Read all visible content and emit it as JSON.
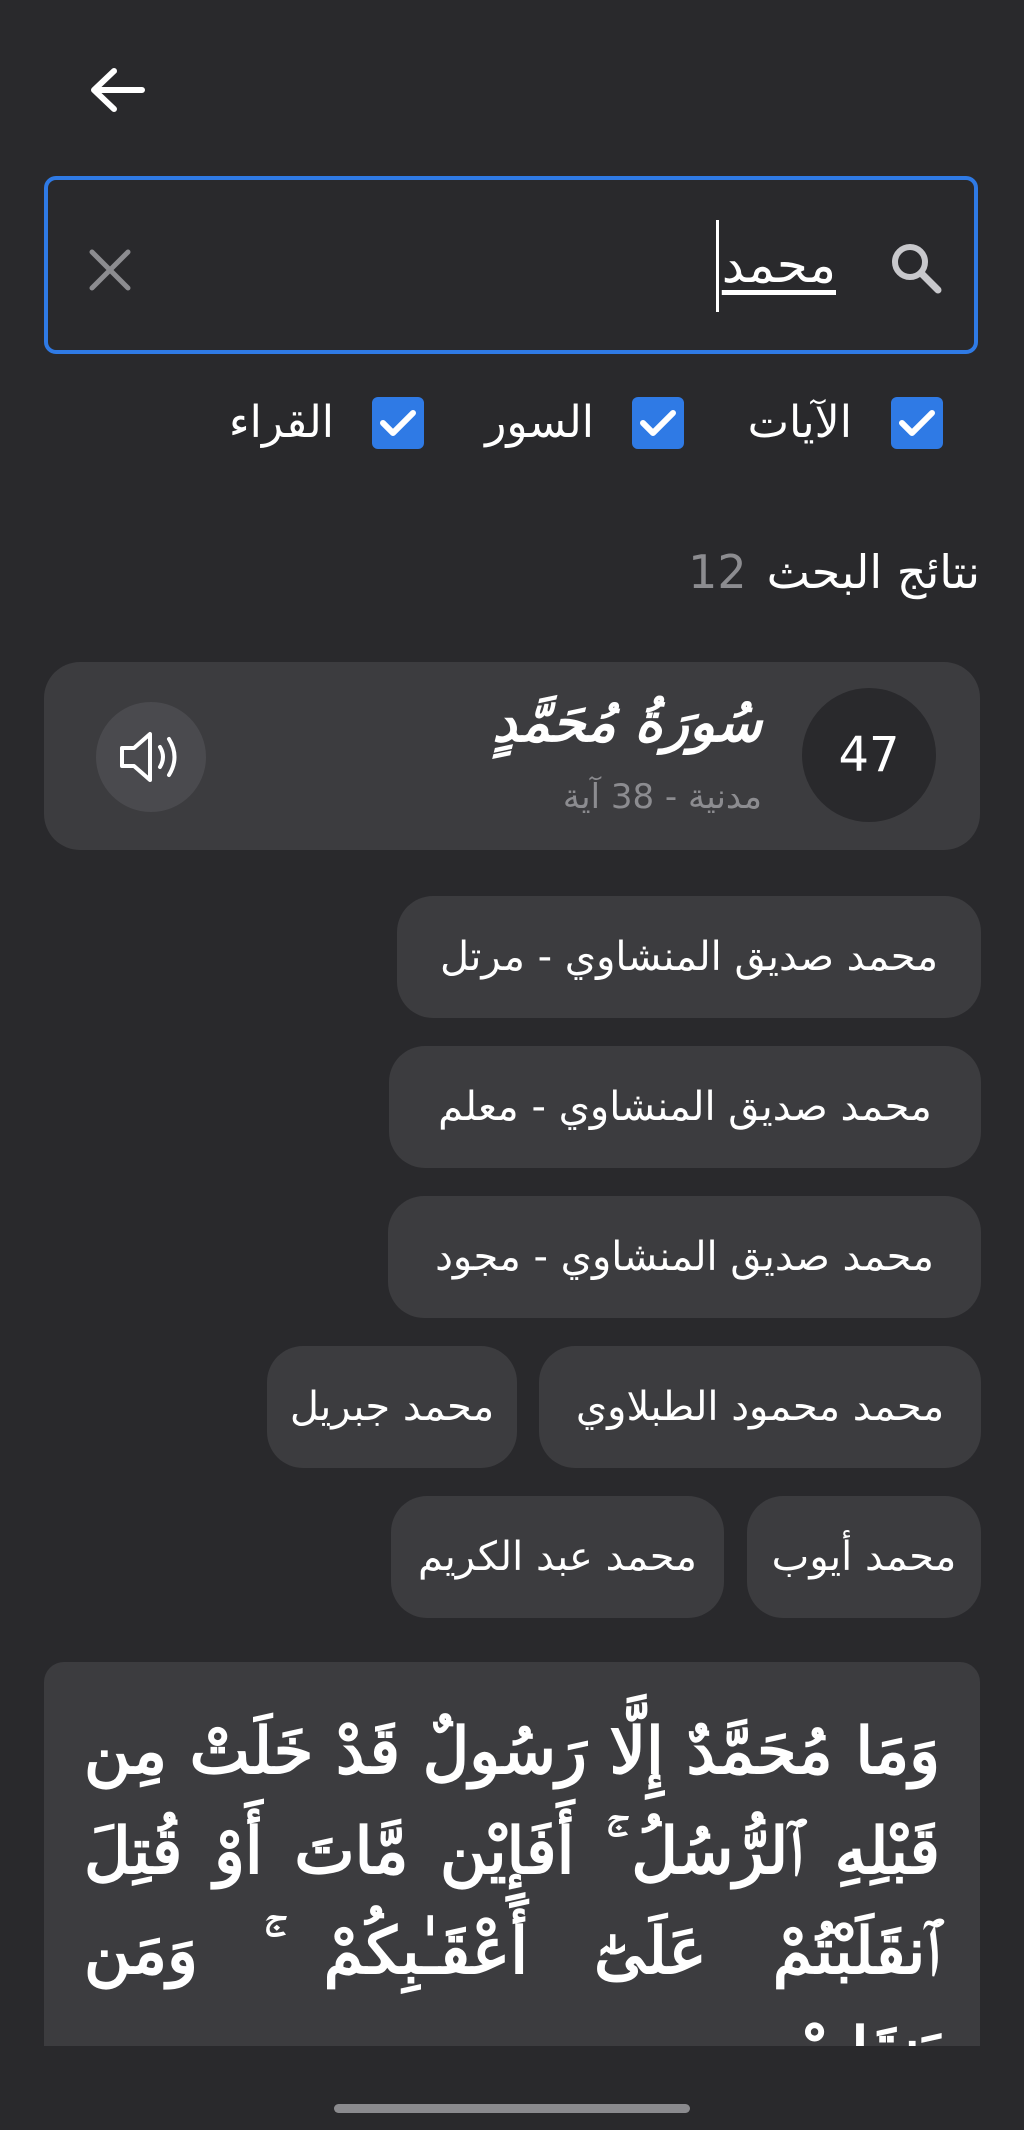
{
  "search": {
    "query": "محمد"
  },
  "filters": [
    {
      "label": "الآيات",
      "checked": true
    },
    {
      "label": "السور",
      "checked": true
    },
    {
      "label": "القراء",
      "checked": true
    }
  ],
  "results": {
    "title": "نتائج البحث",
    "count": "12"
  },
  "surah": {
    "number": "47",
    "name": "سُورَةُ مُحَمَّدٍ",
    "meta": "مدنية - 38 آية"
  },
  "reciters": [
    "محمد صديق المنشاوي - مرتل",
    "محمد صديق المنشاوي - معلم",
    "محمد صديق المنشاوي - مجود",
    "محمد محمود الطبلاوي",
    "محمد جبريل",
    "محمد أيوب",
    "محمد عبد الكريم"
  ],
  "verse": {
    "text": "وَمَا مُحَمَّدٌ إِلَّا رَسُولٌ قَدْ خَلَتْ مِن قَبْلِهِ ٱلرُّسُلُ ۚ أَفَإِيْن مَّاتَ أَوْ قُتِلَ ٱنقَلَبْتُمْ عَلَىٰٓ أَعْقَـٰبِكُمْ ۚ وَمَن يَنقَلِبْ"
  },
  "colors": {
    "background": "#29292c",
    "card": "#3c3c3f",
    "accent": "#2f7ae5",
    "muted": "#8c8c90"
  },
  "icons": [
    "back-arrow-icon",
    "search-icon",
    "clear-icon",
    "check-icon",
    "speaker-icon"
  ]
}
